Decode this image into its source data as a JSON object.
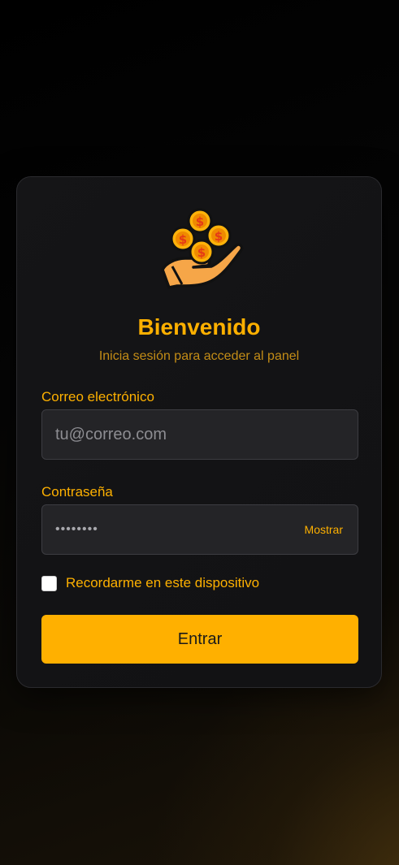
{
  "login": {
    "logo_icon": "hand-with-coins-icon",
    "title": "Bienvenido",
    "subtitle": "Inicia sesión para acceder al panel",
    "email": {
      "label": "Correo electrónico",
      "placeholder": "tu@correo.com",
      "value": ""
    },
    "password": {
      "label": "Contraseña",
      "masked_value": "••••••••",
      "show_label": "Mostrar"
    },
    "remember": {
      "label": "Recordarme en este dispositivo",
      "checked": false
    },
    "submit_label": "Entrar"
  },
  "colors": {
    "accent": "#fdb000",
    "button": "#ffb000",
    "card_background": "#131315",
    "input_background": "#242427",
    "page_background": "#000000"
  }
}
